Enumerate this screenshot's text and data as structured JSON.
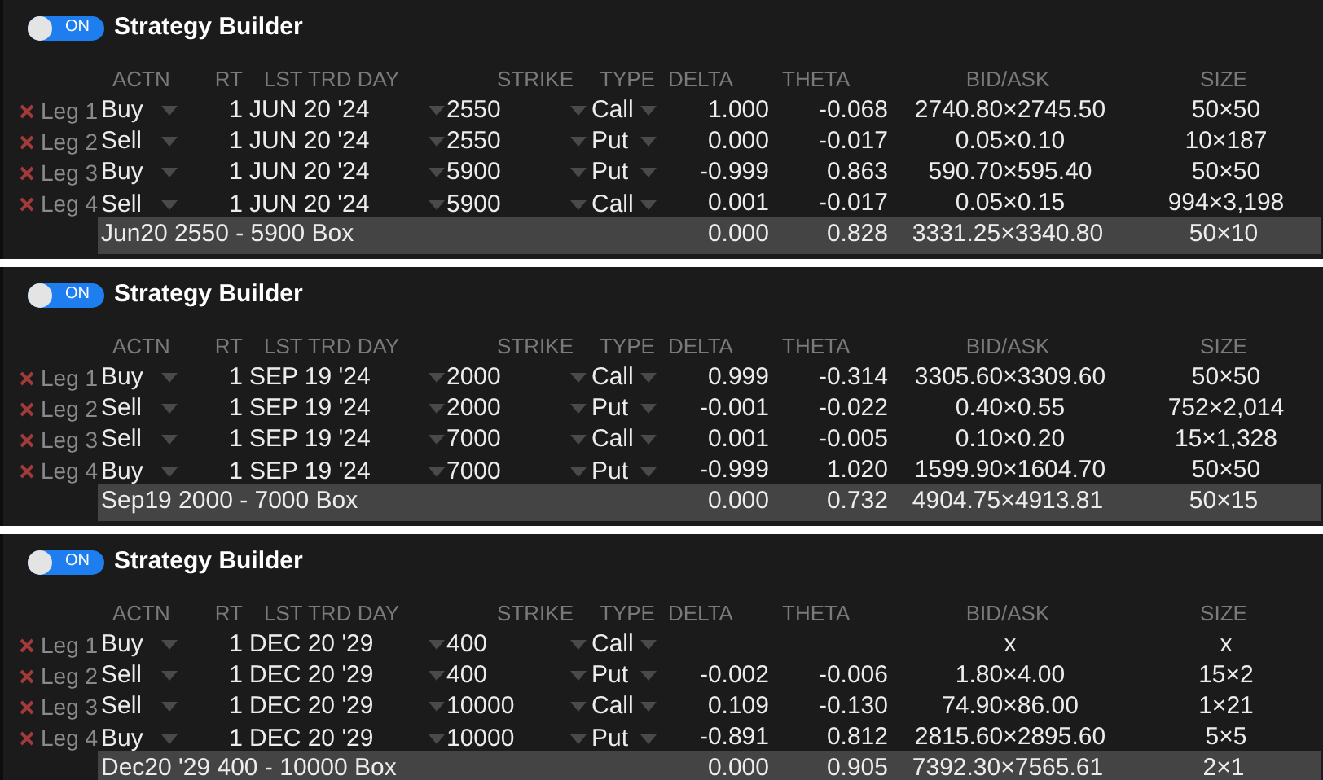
{
  "panels": [
    {
      "toggle": {
        "label": "ON",
        "on": true
      },
      "title": "Strategy Builder",
      "columns": [
        "ACTN",
        "RT",
        "LST TRD DAY",
        "STRIKE",
        "TYPE",
        "DELTA",
        "THETA",
        "BID/ASK",
        "SIZE"
      ],
      "legs": [
        {
          "label": "Leg 1",
          "action": "Buy",
          "ratio": "1",
          "last_trade_day": "JUN 20 '24",
          "strike": "2550",
          "type": "Call",
          "delta": "1.000",
          "theta": "-0.068",
          "bid_ask": "2740.80×2745.50",
          "size": "50×50"
        },
        {
          "label": "Leg 2",
          "action": "Sell",
          "ratio": "1",
          "last_trade_day": "JUN 20 '24",
          "strike": "2550",
          "type": "Put",
          "delta": "0.000",
          "theta": "-0.017",
          "bid_ask": "0.05×0.10",
          "size": "10×187"
        },
        {
          "label": "Leg 3",
          "action": "Buy",
          "ratio": "1",
          "last_trade_day": "JUN 20 '24",
          "strike": "5900",
          "type": "Put",
          "delta": "-0.999",
          "theta": "0.863",
          "bid_ask": "590.70×595.40",
          "size": "50×50"
        },
        {
          "label": "Leg 4",
          "action": "Sell",
          "ratio": "1",
          "last_trade_day": "JUN 20 '24",
          "strike": "5900",
          "type": "Call",
          "delta": "0.001",
          "theta": "-0.017",
          "bid_ask": "0.05×0.15",
          "size": "994×3,198"
        }
      ],
      "summary": {
        "description": "Jun20 2550 - 5900 Box",
        "delta": "0.000",
        "theta": "0.828",
        "bid_ask": "3331.25×3340.80",
        "size": "50×10"
      }
    },
    {
      "toggle": {
        "label": "ON",
        "on": true
      },
      "title": "Strategy Builder",
      "columns": [
        "ACTN",
        "RT",
        "LST TRD DAY",
        "STRIKE",
        "TYPE",
        "DELTA",
        "THETA",
        "BID/ASK",
        "SIZE"
      ],
      "legs": [
        {
          "label": "Leg 1",
          "action": "Buy",
          "ratio": "1",
          "last_trade_day": "SEP 19 '24",
          "strike": "2000",
          "type": "Call",
          "delta": "0.999",
          "theta": "-0.314",
          "bid_ask": "3305.60×3309.60",
          "size": "50×50"
        },
        {
          "label": "Leg 2",
          "action": "Sell",
          "ratio": "1",
          "last_trade_day": "SEP 19 '24",
          "strike": "2000",
          "type": "Put",
          "delta": "-0.001",
          "theta": "-0.022",
          "bid_ask": "0.40×0.55",
          "size": "752×2,014"
        },
        {
          "label": "Leg 3",
          "action": "Sell",
          "ratio": "1",
          "last_trade_day": "SEP 19 '24",
          "strike": "7000",
          "type": "Call",
          "delta": "0.001",
          "theta": "-0.005",
          "bid_ask": "0.10×0.20",
          "size": "15×1,328"
        },
        {
          "label": "Leg 4",
          "action": "Buy",
          "ratio": "1",
          "last_trade_day": "SEP 19 '24",
          "strike": "7000",
          "type": "Put",
          "delta": "-0.999",
          "theta": "1.020",
          "bid_ask": "1599.90×1604.70",
          "size": "50×50"
        }
      ],
      "summary": {
        "description": "Sep19 2000 - 7000 Box",
        "delta": "0.000",
        "theta": "0.732",
        "bid_ask": "4904.75×4913.81",
        "size": "50×15"
      }
    },
    {
      "toggle": {
        "label": "ON",
        "on": true
      },
      "title": "Strategy Builder",
      "columns": [
        "ACTN",
        "RT",
        "LST TRD DAY",
        "STRIKE",
        "TYPE",
        "DELTA",
        "THETA",
        "BID/ASK",
        "SIZE"
      ],
      "legs": [
        {
          "label": "Leg 1",
          "action": "Buy",
          "ratio": "1",
          "last_trade_day": "DEC 20 '29",
          "strike": "400",
          "type": "Call",
          "bid_ask": "x",
          "size": "x"
        },
        {
          "label": "Leg 2",
          "action": "Sell",
          "ratio": "1",
          "last_trade_day": "DEC 20 '29",
          "strike": "400",
          "type": "Put",
          "delta": "-0.002",
          "theta": "-0.006",
          "bid_ask": "1.80×4.00",
          "size": "15×2"
        },
        {
          "label": "Leg 3",
          "action": "Sell",
          "ratio": "1",
          "last_trade_day": "DEC 20 '29",
          "strike": "10000",
          "type": "Call",
          "delta": "0.109",
          "theta": "-0.130",
          "bid_ask": "74.90×86.00",
          "size": "1×21"
        },
        {
          "label": "Leg 4",
          "action": "Buy",
          "ratio": "1",
          "last_trade_day": "DEC 20 '29",
          "strike": "10000",
          "type": "Put",
          "delta": "-0.891",
          "theta": "0.812",
          "bid_ask": "2815.60×2895.60",
          "size": "5×5"
        }
      ],
      "summary": {
        "description": "Dec20 '29 400 - 10000 Box",
        "delta": "0.000",
        "theta": "0.905",
        "bid_ask": "7392.30×7565.61",
        "size": "2×1"
      }
    }
  ]
}
